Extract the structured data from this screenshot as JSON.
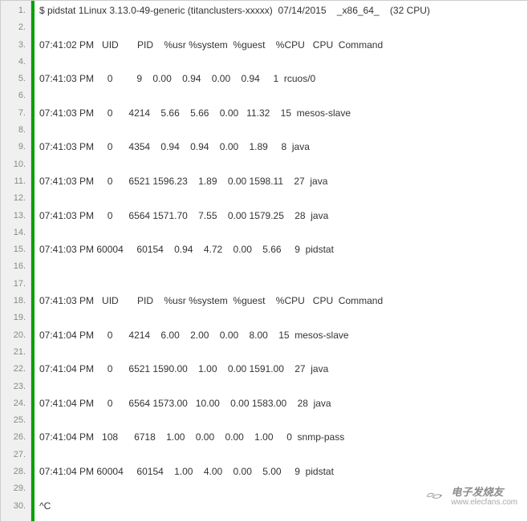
{
  "line_count": 30,
  "lines": [
    "$ pidstat 1Linux 3.13.0-49-generic (titanclusters-xxxxx)  07/14/2015    _x86_64_    (32 CPU)",
    "",
    "07:41:02 PM   UID       PID    %usr %system  %guest    %CPU   CPU  Command",
    "",
    "07:41:03 PM     0         9    0.00    0.94    0.00    0.94     1  rcuos/0",
    "",
    "07:41:03 PM     0      4214    5.66    5.66    0.00   11.32    15  mesos-slave",
    "",
    "07:41:03 PM     0      4354    0.94    0.94    0.00    1.89     8  java",
    "",
    "07:41:03 PM     0      6521 1596.23    1.89    0.00 1598.11    27  java",
    "",
    "07:41:03 PM     0      6564 1571.70    7.55    0.00 1579.25    28  java",
    "",
    "07:41:03 PM 60004     60154    0.94    4.72    0.00    5.66     9  pidstat",
    "",
    "",
    "07:41:03 PM   UID       PID    %usr %system  %guest    %CPU   CPU  Command",
    "",
    "07:41:04 PM     0      4214    6.00    2.00    0.00    8.00    15  mesos-slave",
    "",
    "07:41:04 PM     0      6521 1590.00    1.00    0.00 1591.00    27  java",
    "",
    "07:41:04 PM     0      6564 1573.00   10.00    0.00 1583.00    28  java",
    "",
    "07:41:04 PM   108      6718    1.00    0.00    0.00    1.00     0  snmp-pass",
    "",
    "07:41:04 PM 60004     60154    1.00    4.00    0.00    5.00     9  pidstat",
    "",
    "^C"
  ],
  "watermark": {
    "cn": "电子发烧友",
    "url": "www.elecfans.com"
  }
}
